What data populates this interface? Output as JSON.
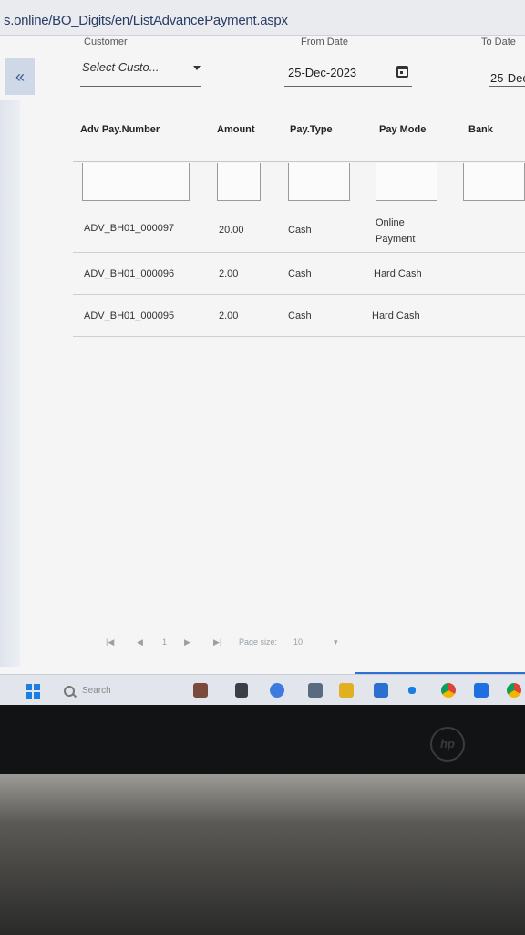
{
  "browser": {
    "url": "s.online/BO_Digits/en/ListAdvancePayment.aspx"
  },
  "sidebar": {
    "collapse_label": "«"
  },
  "filters": {
    "customer": {
      "label": "Customer",
      "value": "Select Custo..."
    },
    "from_date": {
      "label": "From Date",
      "value": "25-Dec-2023"
    },
    "to_date": {
      "label": "To Date",
      "value": "25-Dec"
    }
  },
  "table": {
    "columns": [
      "Adv Pay.Number",
      "Amount",
      "Pay.Type",
      "Pay Mode",
      "Bank"
    ],
    "rows": [
      {
        "number": "ADV_BH01_000097",
        "amount": "20.00",
        "type": "Cash",
        "mode_line1": "Online",
        "mode_line2": "Payment"
      },
      {
        "number": "ADV_BH01_000096",
        "amount": "2.00",
        "type": "Cash",
        "mode_line1": "Hard Cash",
        "mode_line2": ""
      },
      {
        "number": "ADV_BH01_000095",
        "amount": "2.00",
        "type": "Cash",
        "mode_line1": "Hard Cash",
        "mode_line2": ""
      }
    ]
  },
  "pager": {
    "first": "|◀",
    "prev": "◀",
    "page": "1",
    "next": "▶",
    "last": "▶|",
    "size_label": "Page size:",
    "size_value": "10"
  },
  "taskbar": {
    "search_placeholder": "Search"
  },
  "colors": {
    "accent": "#2f6fd6",
    "windows_blue": "#1a7fe0"
  }
}
